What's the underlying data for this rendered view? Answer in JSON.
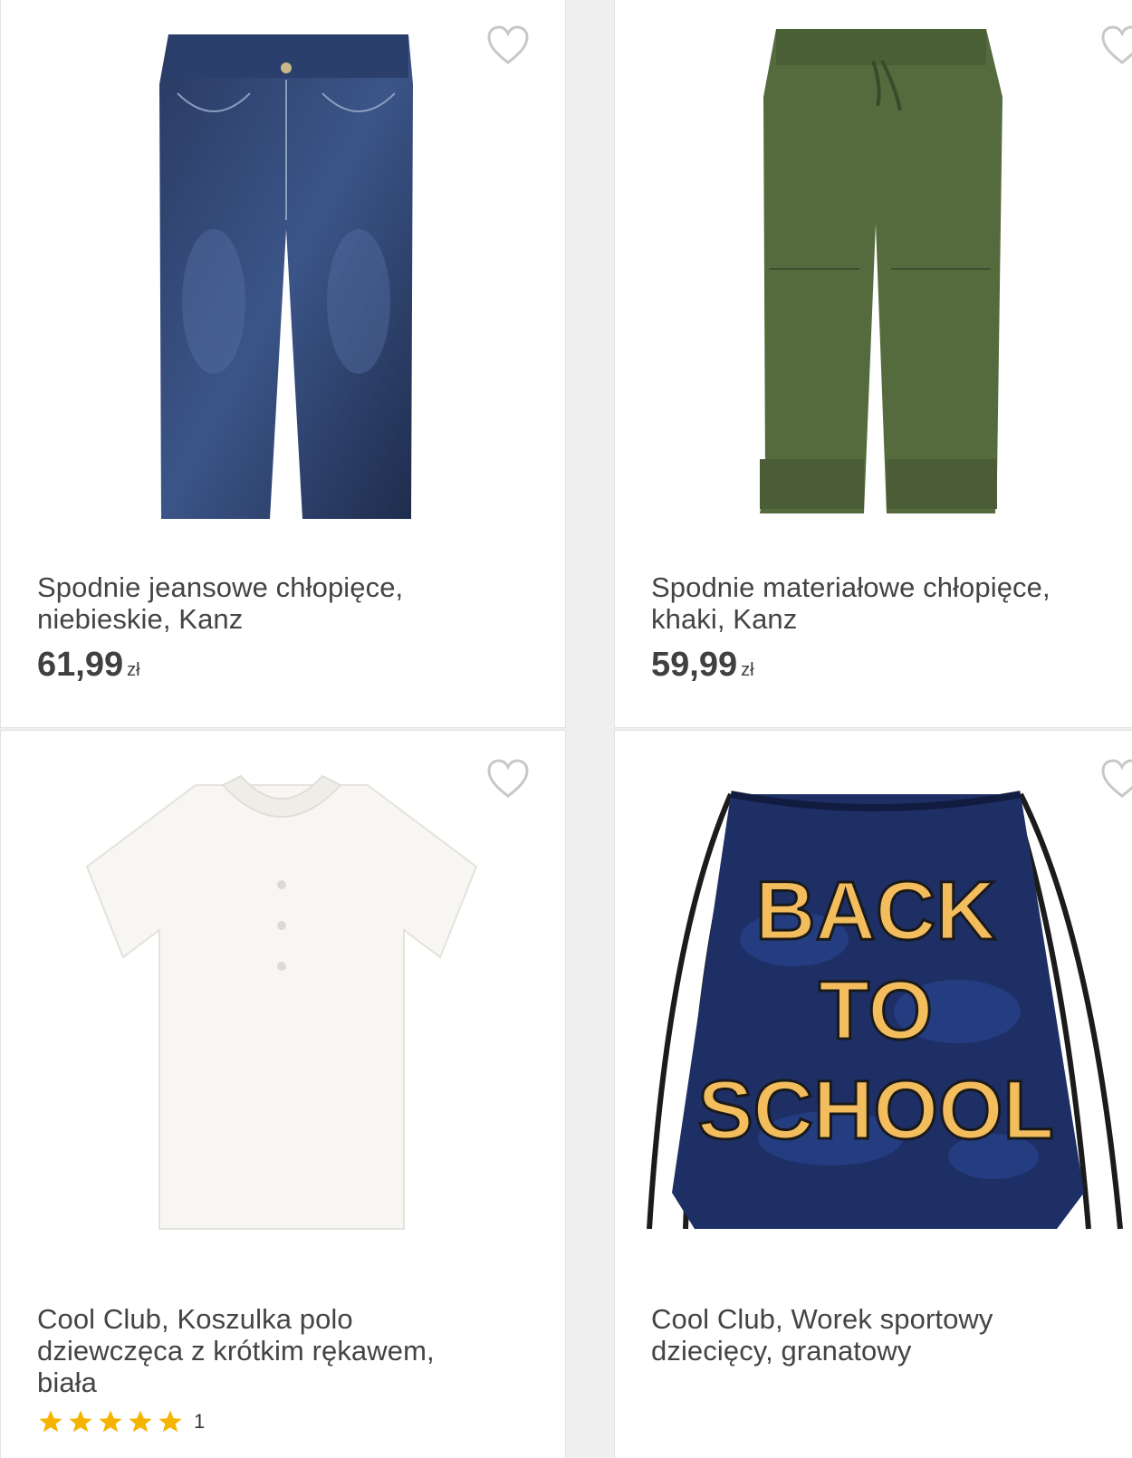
{
  "products": [
    {
      "name_line1": "Spodnie jeansowe chłopięce,",
      "name_line2": "niebieskie, Kanz",
      "price": "61,99",
      "currency": "zł",
      "image": "jeans-blue"
    },
    {
      "name_line1": "Spodnie materiałowe chłopięce,",
      "name_line2": "khaki, Kanz",
      "price": "59,99",
      "currency": "zł",
      "image": "trousers-khaki"
    },
    {
      "name_line1": "Cool Club, Koszulka polo",
      "name_line2": "dziewczęca z krótkim rękawem,",
      "name_line3": "biała",
      "rating_stars": 5,
      "rating_count": "1",
      "image": "polo-white"
    },
    {
      "name_line1": "Cool Club, Worek sportowy",
      "name_line2": "dziecięcy, granatowy",
      "bag_text": [
        "BACK",
        "TO",
        "SCHOOL"
      ],
      "image": "drawstring-bag-navy"
    }
  ],
  "colors": {
    "star": "#f5b400",
    "heart_outline": "#c8c8c8",
    "price_text": "#404040"
  },
  "icons": {
    "favorite": "heart-outline-icon",
    "rating": "star-icon"
  }
}
